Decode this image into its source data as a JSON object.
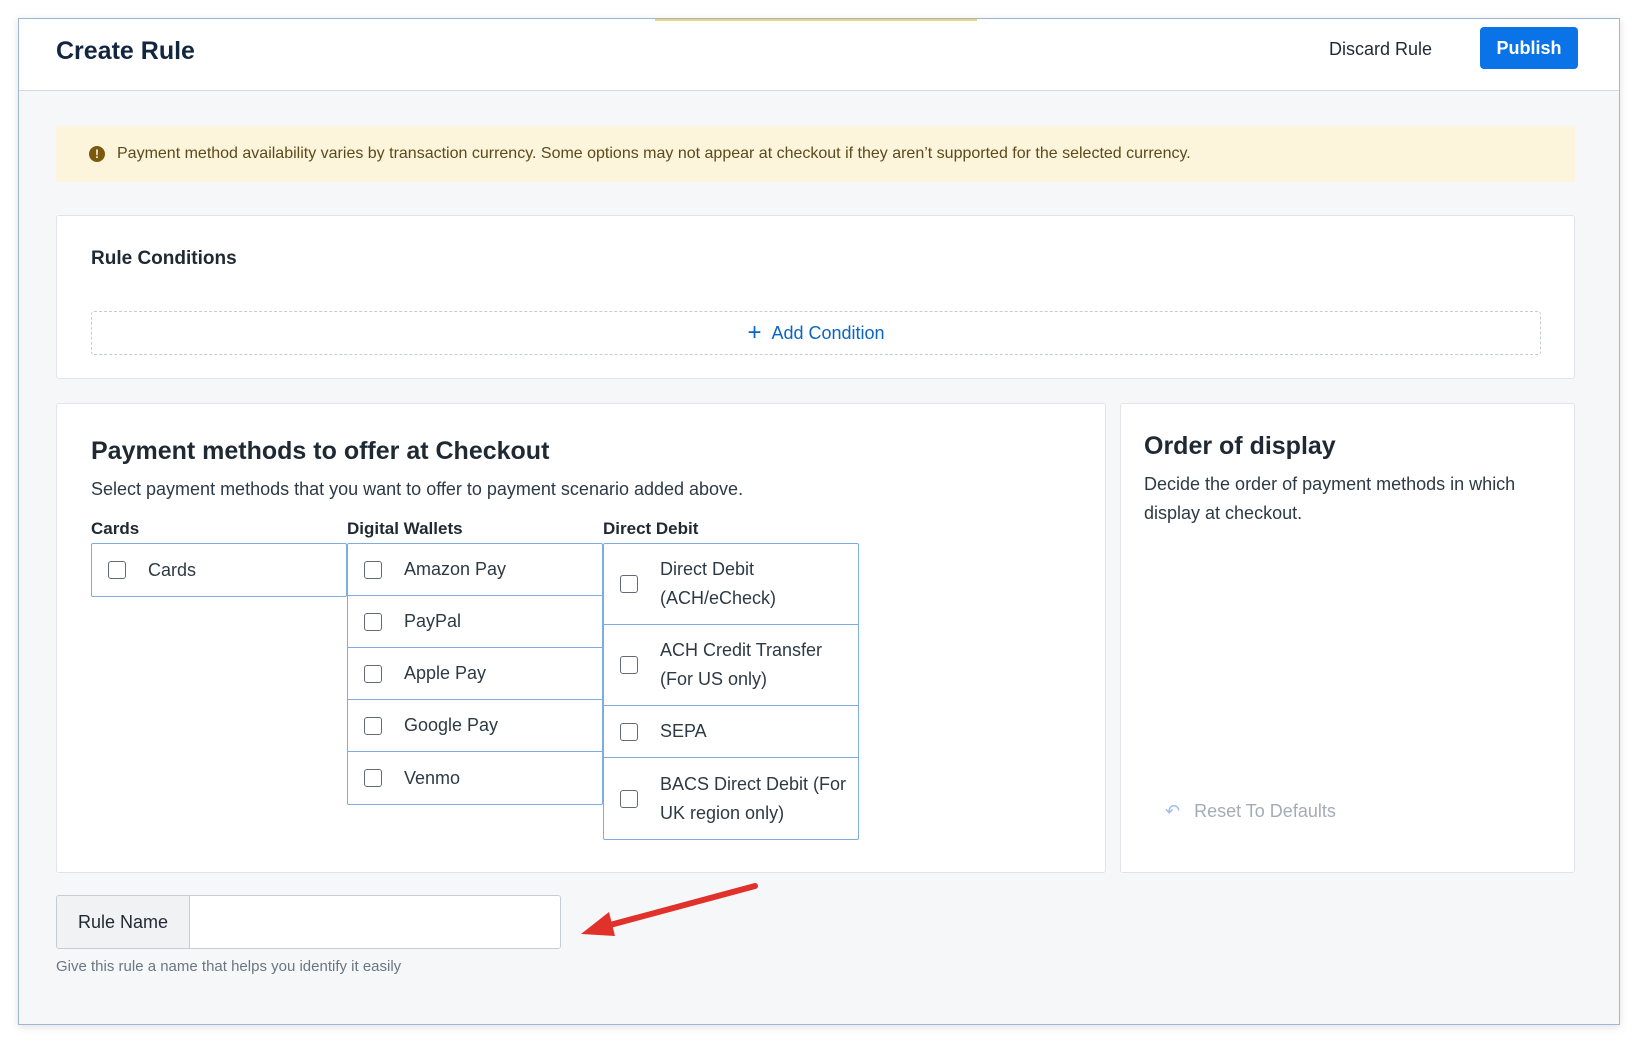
{
  "header": {
    "title": "Create Rule",
    "discard_label": "Discard Rule",
    "publish_label": "Publish"
  },
  "banner": {
    "icon": "alert-circle-icon",
    "text": "Payment method availability varies by transaction currency. Some options may not appear at checkout if they aren’t supported for the selected currency."
  },
  "conditions": {
    "title": "Rule Conditions",
    "add_label": "Add Condition"
  },
  "payment_methods": {
    "title": "Payment methods to offer at Checkout",
    "subtitle": "Select payment methods that you want to offer to payment scenario added above.",
    "groups": [
      {
        "label": "Cards",
        "options": [
          "Cards"
        ]
      },
      {
        "label": "Digital Wallets",
        "options": [
          "Amazon Pay",
          "PayPal",
          "Apple Pay",
          "Google Pay",
          "Venmo"
        ]
      },
      {
        "label": "Direct Debit",
        "options": [
          "Direct Debit (ACH/eCheck)",
          "ACH Credit Transfer (For US only)",
          "SEPA",
          "BACS Direct Debit (For UK region only)"
        ]
      }
    ]
  },
  "order": {
    "title": "Order of display",
    "description": "Decide the order of payment methods in which display at checkout.",
    "reset_label": "Reset To Defaults"
  },
  "rule_name": {
    "label": "Rule Name",
    "value": "",
    "placeholder": "",
    "hint": "Give this rule a name that helps you identify it easily"
  },
  "colors": {
    "primary": "#0a73e8",
    "banner_bg": "#fdf4dc",
    "annotation_arrow": "#e0322b"
  }
}
